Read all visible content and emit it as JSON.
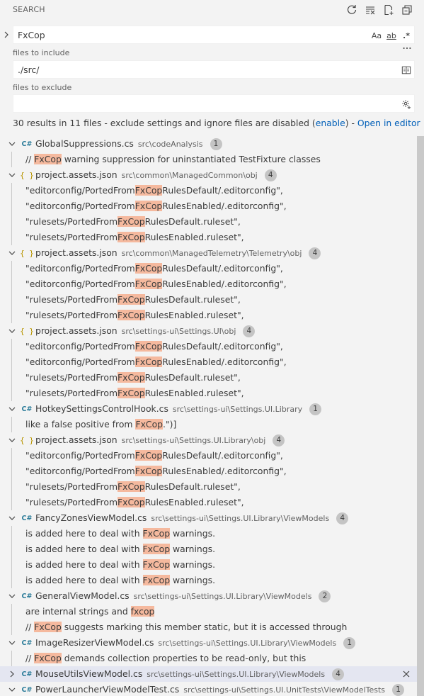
{
  "panel": {
    "title": "SEARCH"
  },
  "search": {
    "query": "FxCop",
    "opt_case": "Aa",
    "opt_word": "ab",
    "opt_regex": ".*"
  },
  "include": {
    "label": "files to include",
    "value": "./src/"
  },
  "exclude": {
    "label": "files to exclude",
    "value": ""
  },
  "summary": {
    "text": "30 results in 11 files - exclude settings and ignore files are disabled (",
    "enable": "enable",
    "mid": ") - ",
    "open_editor": "Open in editor"
  },
  "groups": [
    {
      "name": "GlobalSuppressions.cs",
      "type": "cs",
      "path": "src\\codeAnalysis",
      "count": "1",
      "expanded": true,
      "matches": [
        {
          "pre": "// ",
          "hit": "FxCop",
          "post": " warning suppression for uninstantiated TestFixture classes"
        }
      ]
    },
    {
      "name": "project.assets.json",
      "type": "json",
      "path": "src\\common\\ManagedCommon\\obj",
      "count": "4",
      "expanded": true,
      "matches": [
        {
          "pre": "\"editorconfig/PortedFrom",
          "hit": "FxCop",
          "post": "RulesDefault/.editorconfig\","
        },
        {
          "pre": "\"editorconfig/PortedFrom",
          "hit": "FxCop",
          "post": "RulesEnabled/.editorconfig\","
        },
        {
          "pre": "\"rulesets/PortedFrom",
          "hit": "FxCop",
          "post": "RulesDefault.ruleset\","
        },
        {
          "pre": "\"rulesets/PortedFrom",
          "hit": "FxCop",
          "post": "RulesEnabled.ruleset\","
        }
      ]
    },
    {
      "name": "project.assets.json",
      "type": "json",
      "path": "src\\common\\ManagedTelemetry\\Telemetry\\obj",
      "count": "4",
      "expanded": true,
      "matches": [
        {
          "pre": "\"editorconfig/PortedFrom",
          "hit": "FxCop",
          "post": "RulesDefault/.editorconfig\","
        },
        {
          "pre": "\"editorconfig/PortedFrom",
          "hit": "FxCop",
          "post": "RulesEnabled/.editorconfig\","
        },
        {
          "pre": "\"rulesets/PortedFrom",
          "hit": "FxCop",
          "post": "RulesDefault.ruleset\","
        },
        {
          "pre": "\"rulesets/PortedFrom",
          "hit": "FxCop",
          "post": "RulesEnabled.ruleset\","
        }
      ]
    },
    {
      "name": "project.assets.json",
      "type": "json",
      "path": "src\\settings-ui\\Settings.UI\\obj",
      "count": "4",
      "expanded": true,
      "matches": [
        {
          "pre": "\"editorconfig/PortedFrom",
          "hit": "FxCop",
          "post": "RulesDefault/.editorconfig\","
        },
        {
          "pre": "\"editorconfig/PortedFrom",
          "hit": "FxCop",
          "post": "RulesEnabled/.editorconfig\","
        },
        {
          "pre": "\"rulesets/PortedFrom",
          "hit": "FxCop",
          "post": "RulesDefault.ruleset\","
        },
        {
          "pre": "\"rulesets/PortedFrom",
          "hit": "FxCop",
          "post": "RulesEnabled.ruleset\","
        }
      ]
    },
    {
      "name": "HotkeySettingsControlHook.cs",
      "type": "cs",
      "path": "src\\settings-ui\\Settings.UI.Library",
      "count": "1",
      "expanded": true,
      "matches": [
        {
          "pre": "like a false positive from ",
          "hit": "FxCop",
          "post": ".\")]"
        }
      ]
    },
    {
      "name": "project.assets.json",
      "type": "json",
      "path": "src\\settings-ui\\Settings.UI.Library\\obj",
      "count": "4",
      "expanded": true,
      "matches": [
        {
          "pre": "\"editorconfig/PortedFrom",
          "hit": "FxCop",
          "post": "RulesDefault/.editorconfig\","
        },
        {
          "pre": "\"editorconfig/PortedFrom",
          "hit": "FxCop",
          "post": "RulesEnabled/.editorconfig\","
        },
        {
          "pre": "\"rulesets/PortedFrom",
          "hit": "FxCop",
          "post": "RulesDefault.ruleset\","
        },
        {
          "pre": "\"rulesets/PortedFrom",
          "hit": "FxCop",
          "post": "RulesEnabled.ruleset\","
        }
      ]
    },
    {
      "name": "FancyZonesViewModel.cs",
      "type": "cs",
      "path": "src\\settings-ui\\Settings.UI.Library\\ViewModels",
      "count": "4",
      "expanded": true,
      "matches": [
        {
          "pre": "is added here to deal with ",
          "hit": "FxCop",
          "post": " warnings."
        },
        {
          "pre": "is added here to deal with ",
          "hit": "FxCop",
          "post": " warnings."
        },
        {
          "pre": "is added here to deal with ",
          "hit": "FxCop",
          "post": " warnings."
        },
        {
          "pre": "is added here to deal with ",
          "hit": "FxCop",
          "post": " warnings."
        }
      ]
    },
    {
      "name": "GeneralViewModel.cs",
      "type": "cs",
      "path": "src\\settings-ui\\Settings.UI.Library\\ViewModels",
      "count": "2",
      "expanded": true,
      "matches": [
        {
          "pre": "are internal strings and ",
          "hit": "fxcop",
          "post": ""
        },
        {
          "pre": "// ",
          "hit": "FxCop",
          "post": " suggests marking this member static, but it is accessed through"
        }
      ]
    },
    {
      "name": "ImageResizerViewModel.cs",
      "type": "cs",
      "path": "src\\settings-ui\\Settings.UI.Library\\ViewModels",
      "count": "1",
      "expanded": true,
      "matches": [
        {
          "pre": "// ",
          "hit": "FxCop",
          "post": " demands collection properties to be read-only, but this"
        }
      ]
    },
    {
      "name": "MouseUtilsViewModel.cs",
      "type": "cs",
      "path": "src\\settings-ui\\Settings.UI.Library\\ViewModels",
      "count": "4",
      "expanded": false,
      "active": true,
      "matches": []
    },
    {
      "name": "PowerLauncherViewModelTest.cs",
      "type": "cs",
      "path": "src\\settings-ui\\Settings.UI.UnitTests\\ViewModelTests",
      "count": "1",
      "expanded": true,
      "matches": []
    }
  ]
}
